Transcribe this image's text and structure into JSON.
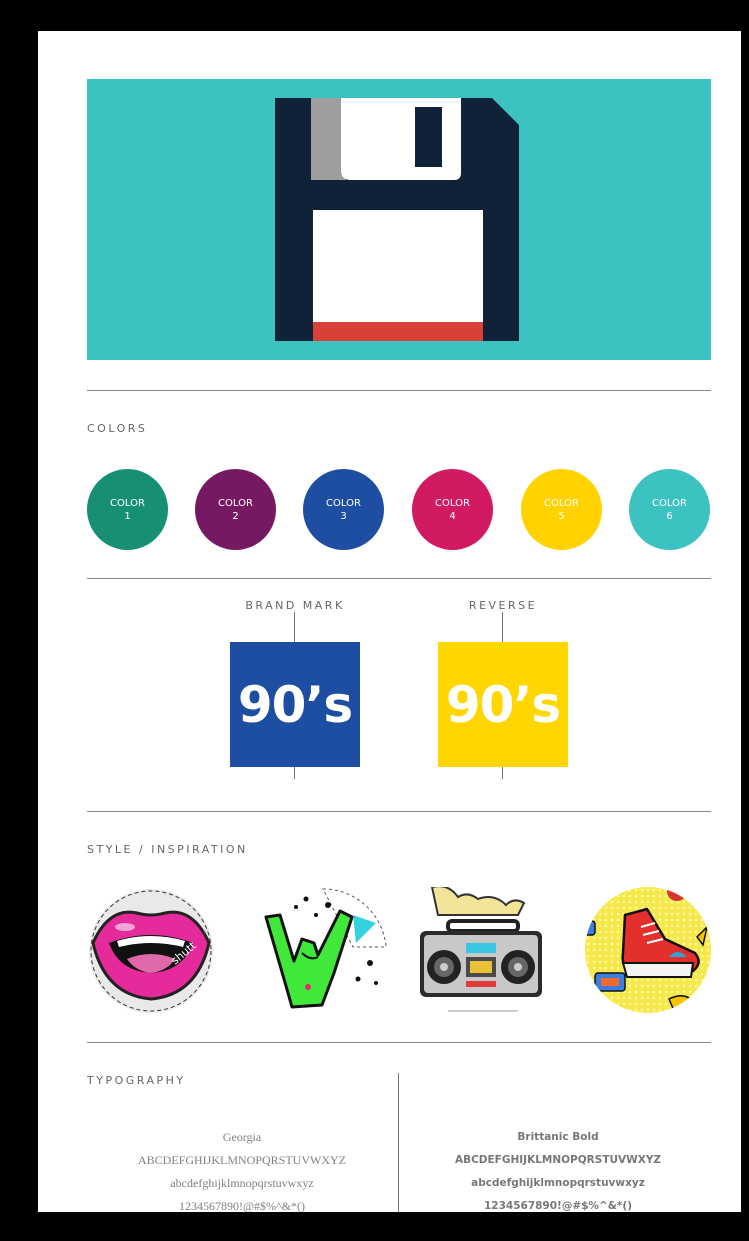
{
  "colors": {
    "page_bg": "#ffffff",
    "hero_bg": "#3cc3c1",
    "disk_body": "#0f2238",
    "disk_label_stripe": "#d8403a",
    "shutter_gray": "#9e9e9e"
  },
  "hero": {
    "icon": "floppy-disk-icon"
  },
  "colors_section": {
    "label": "COLORS",
    "swatches": [
      {
        "line1": "COLOR",
        "line2": "1",
        "color": "#168f74"
      },
      {
        "line1": "COLOR",
        "line2": "2",
        "color": "#761963"
      },
      {
        "line1": "COLOR",
        "line2": "3",
        "color": "#1e4ea2"
      },
      {
        "line1": "COLOR",
        "line2": "4",
        "color": "#d21a62"
      },
      {
        "line1": "COLOR",
        "line2": "5",
        "color": "#ffd200"
      },
      {
        "line1": "COLOR",
        "line2": "6",
        "color": "#3cc3c1"
      }
    ]
  },
  "marks": {
    "brand": {
      "label": "BRAND MARK",
      "text": "90’s",
      "color": "#1e4ea2"
    },
    "reverse": {
      "label": "REVERSE",
      "text": "90’s",
      "color": "#ffd600"
    }
  },
  "style_section": {
    "label": "STYLE / INSPIRATION",
    "images": [
      "lips-sticker-image",
      "rock-hand-image",
      "boombox-image",
      "sneaker-pattern-image"
    ],
    "watermark": "shutt"
  },
  "typography": {
    "label": "TYPOGRAPHY",
    "left": {
      "name": "Georgia",
      "upper": "ABCDEFGHIJKLMNOPQRSTUVWXYZ",
      "lower": "abcdefghijklmnopqrstuvwxyz",
      "digits": "1234567890!@#$%^&*()"
    },
    "right": {
      "name": "Brittanic Bold",
      "upper": "ABCDEFGHIJKLMNOPQRSTUVWXYZ",
      "lower": "abcdefghijklmnopqrstuvwxyz",
      "digits": "1234567890!@#$%^&*()"
    }
  }
}
